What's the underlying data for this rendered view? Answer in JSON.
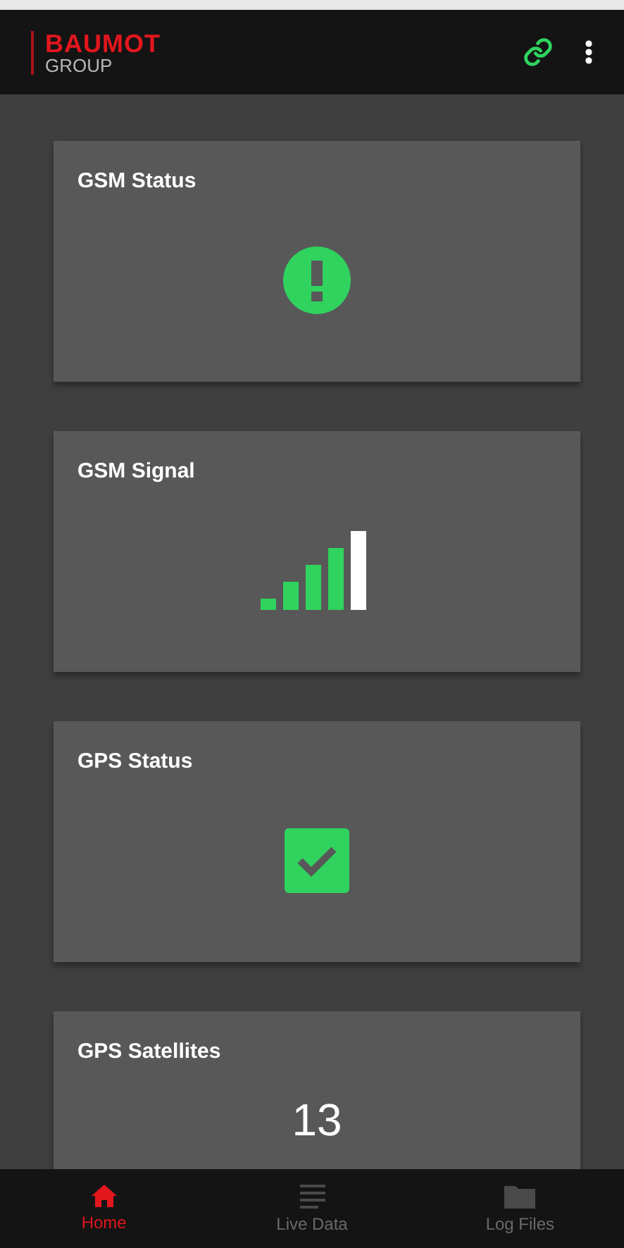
{
  "header": {
    "logo_top": "BAUMOT",
    "logo_bottom": "GROUP",
    "connected": true
  },
  "cards": [
    {
      "title": "GSM Status",
      "kind": "alert"
    },
    {
      "title": "GSM Signal",
      "kind": "signal",
      "level": 0.8
    },
    {
      "title": "GPS Status",
      "kind": "check"
    },
    {
      "title": "GPS Satellites",
      "kind": "number",
      "value": "13"
    }
  ],
  "nav": [
    {
      "label": "Home",
      "kind": "home",
      "selected": true
    },
    {
      "label": "Live Data",
      "kind": "list",
      "selected": false
    },
    {
      "label": "Log Files",
      "kind": "folder",
      "selected": false
    }
  ]
}
